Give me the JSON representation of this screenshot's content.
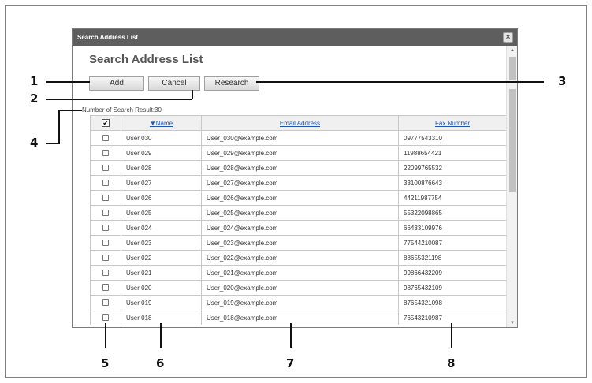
{
  "dialog": {
    "title": "Search Address List",
    "close_glyph": "×",
    "heading": "Search Address List"
  },
  "toolbar": {
    "add_label": "Add",
    "cancel_label": "Cancel",
    "research_label": "Research"
  },
  "result_text": "Number of Search Result:30",
  "table": {
    "headers": {
      "check": "✔",
      "sort_glyph": "▼",
      "name": "Name",
      "email": "Email Address",
      "fax": "Fax Number"
    },
    "rows": [
      {
        "name": "User 030",
        "email": "User_030@example.com",
        "fax": "09777543310"
      },
      {
        "name": "User 029",
        "email": "User_029@example.com",
        "fax": "11988654421"
      },
      {
        "name": "User 028",
        "email": "User_028@example.com",
        "fax": "22099765532"
      },
      {
        "name": "User 027",
        "email": "User_027@example.com",
        "fax": "33100876643"
      },
      {
        "name": "User 026",
        "email": "User_026@example.com",
        "fax": "44211987754"
      },
      {
        "name": "User 025",
        "email": "User_025@example.com",
        "fax": "55322098865"
      },
      {
        "name": "User 024",
        "email": "User_024@example.com",
        "fax": "66433109976"
      },
      {
        "name": "User 023",
        "email": "User_023@example.com",
        "fax": "77544210087"
      },
      {
        "name": "User 022",
        "email": "User_022@example.com",
        "fax": "88655321198"
      },
      {
        "name": "User 021",
        "email": "User_021@example.com",
        "fax": "99866432209"
      },
      {
        "name": "User 020",
        "email": "User_020@example.com",
        "fax": "98765432109"
      },
      {
        "name": "User 019",
        "email": "User_019@example.com",
        "fax": "87654321098"
      },
      {
        "name": "User 018",
        "email": "User_018@example.com",
        "fax": "76543210987"
      }
    ]
  },
  "callouts": [
    "1",
    "2",
    "3",
    "4",
    "5",
    "6",
    "7",
    "8"
  ],
  "scrollbar": {
    "up": "▲",
    "down": "▼"
  },
  "colors": {
    "titlebar": "#5e5e5e",
    "link": "#2255aa"
  }
}
